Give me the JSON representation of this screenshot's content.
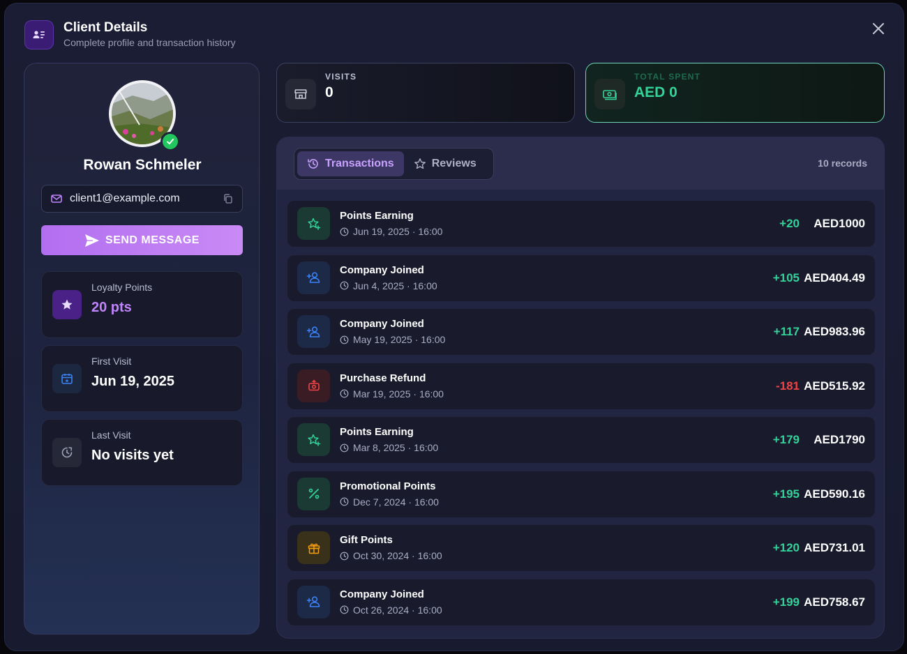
{
  "header": {
    "title": "Client Details",
    "subtitle": "Complete profile and transaction history"
  },
  "profile": {
    "name": "Rowan Schmeler",
    "email": "client1@example.com",
    "send_label": "SEND MESSAGE",
    "loyalty": {
      "label": "Loyalty Points",
      "value": "20 pts"
    },
    "first_visit": {
      "label": "First Visit",
      "value": "Jun 19, 2025"
    },
    "last_visit": {
      "label": "Last Visit",
      "value": "No visits yet"
    }
  },
  "stats": {
    "visits": {
      "label": "VISITS",
      "value": "0"
    },
    "total_spent": {
      "label": "TOTAL SPENT",
      "value": "AED 0"
    }
  },
  "tabs": [
    {
      "label": "Transactions",
      "active": true
    },
    {
      "label": "Reviews",
      "active": false
    }
  ],
  "records_label": "10 records",
  "transactions": [
    {
      "title": "Points Earning",
      "date": "Jun 19, 2025 · 16:00",
      "points": "+20",
      "amount": "AED1000",
      "type": "points",
      "icon": "sparkle-star-icon"
    },
    {
      "title": "Company Joined",
      "date": "Jun 4, 2025 · 16:00",
      "points": "+105",
      "amount": "AED404.49",
      "type": "joined",
      "icon": "user-plus-icon"
    },
    {
      "title": "Company Joined",
      "date": "May 19, 2025 · 16:00",
      "points": "+117",
      "amount": "AED983.96",
      "type": "joined",
      "icon": "user-plus-icon"
    },
    {
      "title": "Purchase Refund",
      "date": "Mar 19, 2025 · 16:00",
      "points": "-181",
      "amount": "AED515.92",
      "type": "refund",
      "icon": "refund-icon"
    },
    {
      "title": "Points Earning",
      "date": "Mar 8, 2025 · 16:00",
      "points": "+179",
      "amount": "AED1790",
      "type": "points",
      "icon": "sparkle-star-icon"
    },
    {
      "title": "Promotional Points",
      "date": "Dec 7, 2024 · 16:00",
      "points": "+195",
      "amount": "AED590.16",
      "type": "promo",
      "icon": "percent-icon"
    },
    {
      "title": "Gift Points",
      "date": "Oct 30, 2024 · 16:00",
      "points": "+120",
      "amount": "AED731.01",
      "type": "gift",
      "icon": "gift-icon"
    },
    {
      "title": "Company Joined",
      "date": "Oct 26, 2024 · 16:00",
      "points": "+199",
      "amount": "AED758.67",
      "type": "joined",
      "icon": "user-plus-icon"
    }
  ],
  "colors": {
    "accent": "#b26ef0",
    "positive": "#34d399",
    "negative": "#ef4444",
    "joined": "#3b82f6",
    "gift": "#f59e0b"
  }
}
